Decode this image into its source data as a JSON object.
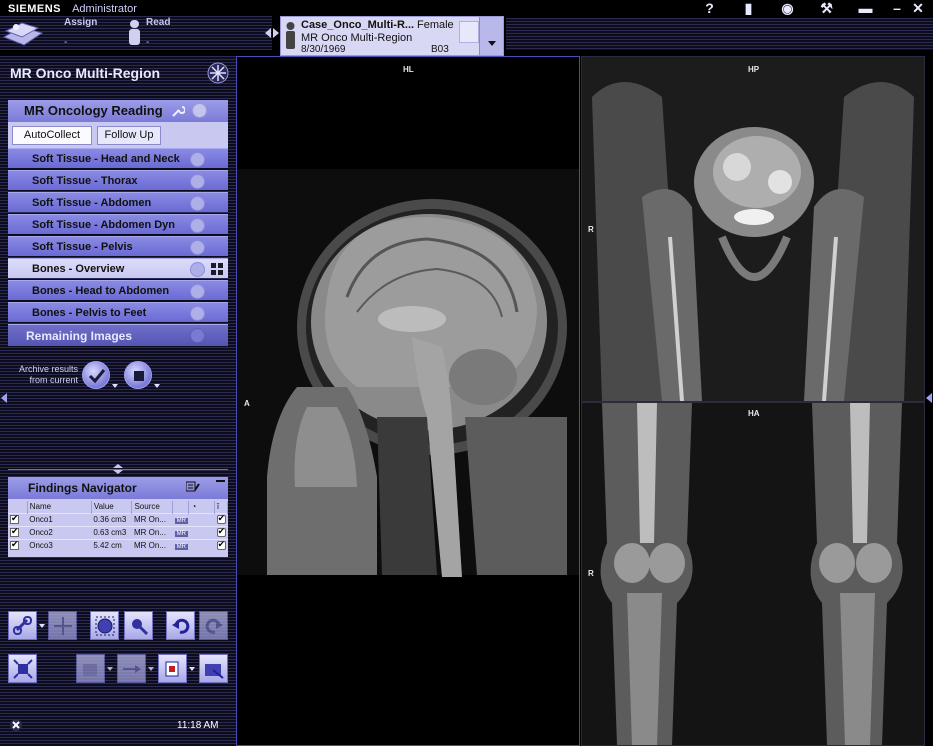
{
  "topbar": {
    "brand": "SIEMENS",
    "user": "Administrator",
    "stages": [
      {
        "label": "Assign",
        "sub": "-"
      },
      {
        "label": "Read",
        "sub": "-"
      }
    ],
    "patient": {
      "name": "Case_Onco_Multi-R...",
      "sex": "Female",
      "exam": "MR Onco Multi-Region",
      "dob": "8/30/1969",
      "region_code": "B03"
    },
    "sys_icons": [
      "help-icon",
      "phone-icon",
      "globe-icon",
      "wrench-icon",
      "briefcase-icon",
      "minimize-icon",
      "close-icon"
    ],
    "sys_glyphs": [
      "?",
      "▮",
      "◉",
      "⚒",
      "▬",
      "–",
      "✕"
    ]
  },
  "sidebar": {
    "workflow_title": "MR Onco Multi-Region",
    "reading_title": "MR Oncology Reading",
    "tabs": [
      {
        "label": "AutoCollect",
        "active": true
      },
      {
        "label": "Follow Up",
        "active": false
      }
    ],
    "steps": [
      {
        "label": "Soft Tissue - Head and Neck"
      },
      {
        "label": "Soft Tissue - Thorax"
      },
      {
        "label": "Soft Tissue - Abdomen"
      },
      {
        "label": "Soft Tissue - Abdomen Dyn"
      },
      {
        "label": "Soft Tissue - Pelvis"
      },
      {
        "label": "Bones - Overview",
        "selected": true
      },
      {
        "label": "Bones - Head to Abdomen"
      },
      {
        "label": "Bones - Pelvis to Feet"
      }
    ],
    "remaining": "Remaining Images",
    "archive_line1": "Archive results",
    "archive_line2": "from current",
    "findings": {
      "title": "Findings Navigator",
      "columns": [
        "Name",
        "Value",
        "Source"
      ],
      "rows": [
        {
          "name": "Onco1",
          "value": "0.36 cm3",
          "source": "MR On...",
          "tag": "MR",
          "checked": true
        },
        {
          "name": "Onco2",
          "value": "0.63 cm3",
          "source": "MR On...",
          "tag": "MR",
          "checked": true
        },
        {
          "name": "Onco3",
          "value": "5.42 cm",
          "source": "MR On...",
          "tag": "MR",
          "checked": true
        }
      ]
    },
    "clock": "11:18 AM"
  },
  "viewports": {
    "left": {
      "top": "HL",
      "left": "A"
    },
    "top_right": {
      "top": "HP",
      "left": "R"
    },
    "bottom_right": {
      "top": "HA",
      "left": "R"
    }
  },
  "colors": {
    "accent": "#7b7bd8",
    "panel_light": "#c8c8f0",
    "viewport_border": "#4a4ab8"
  }
}
